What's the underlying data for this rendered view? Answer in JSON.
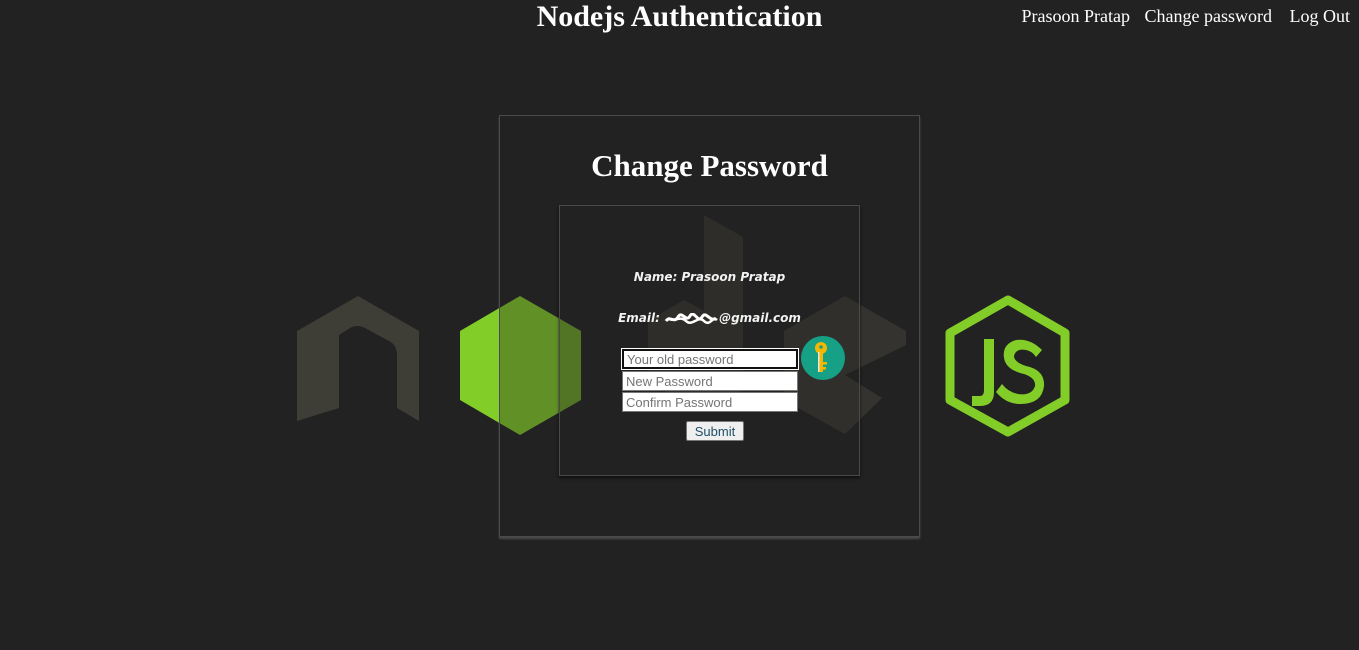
{
  "header": {
    "title": "Nodejs Authentication",
    "nav": {
      "user": "Prasoon Pratap",
      "change_password": "Change password",
      "logout": "Log Out"
    }
  },
  "card": {
    "title": "Change Password",
    "name_line": "Name: Prasoon Pratap",
    "email_label": "Email: ",
    "email_visible_part": "@gmail.com",
    "fields": {
      "old_password_placeholder": "Your old password",
      "new_password_placeholder": "New Password",
      "confirm_password_placeholder": "Confirm Password"
    },
    "submit_label": "Submit"
  },
  "icons": {
    "key": "key-icon",
    "background": "nodejs-logo"
  },
  "colors": {
    "background": "#222222",
    "node_green": "#83cd29",
    "logo_gray": "#3e3d36",
    "key_badge": "#16a085",
    "key_gold": "#f5b700"
  }
}
